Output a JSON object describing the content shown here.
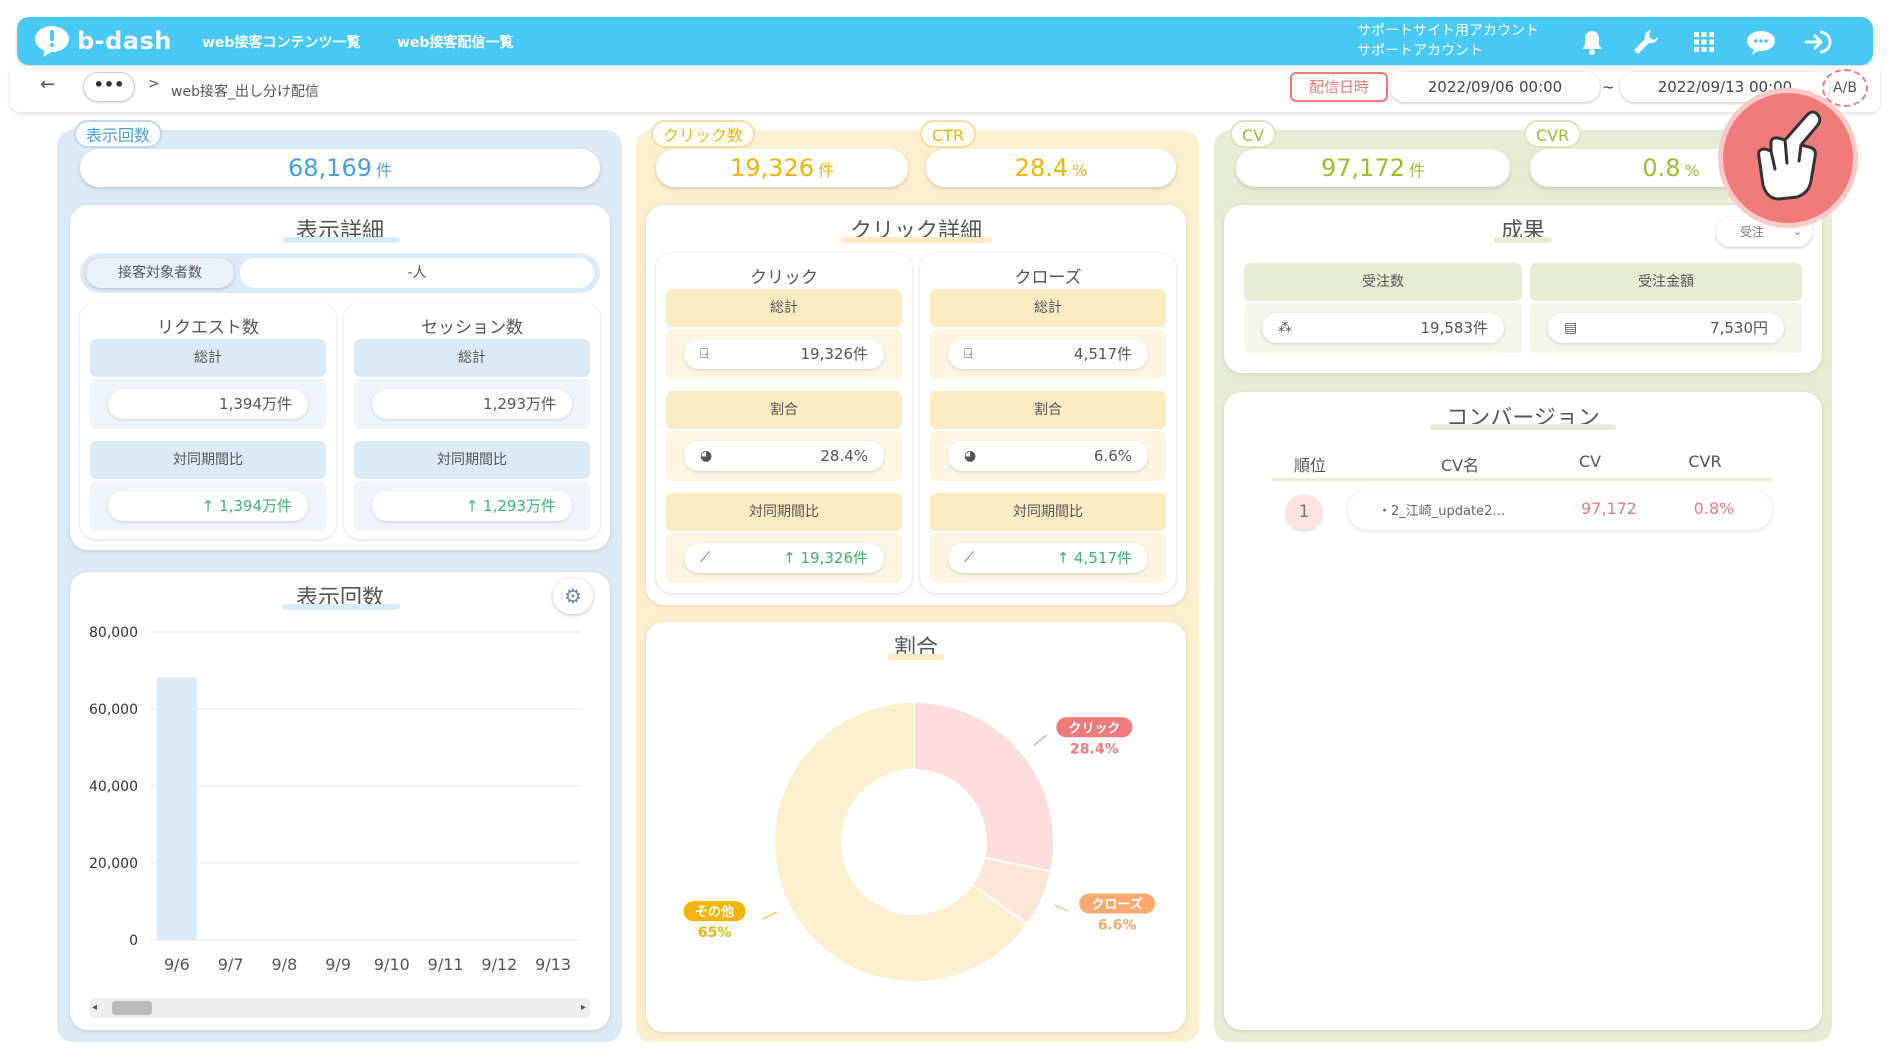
{
  "header": {
    "logo_text": "b-dash",
    "nav": [
      "web接客コンテンツ一覧",
      "web接客配信一覧"
    ],
    "account_line1": "サポートサイト用アカウント",
    "account_line2": "サポートアカウント",
    "icons": [
      "bell-icon",
      "wrench-icon",
      "grid-icon",
      "chat-icon",
      "logout-icon"
    ]
  },
  "subbar": {
    "back": "←",
    "more": "•••",
    "separator": ">",
    "breadcrumb": "web接客_出し分け配信",
    "date_badge": "配信日時",
    "date_from": "2022/09/06 00:00",
    "tilde": "~",
    "date_to": "2022/09/13 00:00",
    "ab_label": "A/B"
  },
  "colors": {
    "blue": "#4a9ee0",
    "yellow": "#f4b400",
    "green": "#9bbf2c",
    "accent_red": "#f07a7a",
    "up_green": "#3cb371"
  },
  "impressions": {
    "tag": "表示回数",
    "value": "68,169",
    "unit": "件",
    "detail_title": "表示詳細",
    "target_label": "接客対象者数",
    "target_value": "-人",
    "requests": {
      "title": "リクエスト数",
      "total_label": "総計",
      "total": "1,394万件",
      "compare_label": "対同期間比",
      "compare": "↑ 1,394万件"
    },
    "sessions": {
      "title": "セッション数",
      "total_label": "総計",
      "total": "1,293万件",
      "compare_label": "対同期間比",
      "compare": "↑ 1,293万件"
    },
    "chart_title": "表示回数"
  },
  "clicks": {
    "tag": "クリック数",
    "value": "19,326",
    "unit": "件",
    "ctr_tag": "CTR",
    "ctr_value": "28.4",
    "ctr_unit": "%",
    "detail_title": "クリック詳細",
    "click": {
      "title": "クリック",
      "total_label": "総計",
      "total": "19,326件",
      "ratio_label": "割合",
      "ratio": "28.4%",
      "compare_label": "対同期間比",
      "compare": "↑ 19,326件"
    },
    "close": {
      "title": "クローズ",
      "total_label": "総計",
      "total": "4,517件",
      "ratio_label": "割合",
      "ratio": "6.6%",
      "compare_label": "対同期間比",
      "compare": "↑ 4,517件"
    },
    "ratio_title": "割合"
  },
  "conversions": {
    "cv_tag": "CV",
    "cv_value": "97,172",
    "cv_unit": "件",
    "cvr_tag": "CVR",
    "cvr_value": "0.8",
    "cvr_unit": "%",
    "results_title": "成果",
    "results_select": "受注",
    "orders_label": "受注数",
    "orders_value": "19,583件",
    "amount_label": "受注金額",
    "amount_value": "7,530円",
    "conv_title": "コンバージョン",
    "table_headers": [
      "順位",
      "CV名",
      "CV",
      "CVR"
    ],
    "rows": [
      {
        "rank": "1",
        "name": "・2_江崎_update2…",
        "cv": "97,172",
        "cvr": "0.8%"
      }
    ]
  },
  "chart_data": [
    {
      "type": "bar",
      "title": "表示回数",
      "categories": [
        "9/6",
        "9/7",
        "9/8",
        "9/9",
        "9/10",
        "9/11",
        "9/12",
        "9/13"
      ],
      "values": [
        68169,
        0,
        0,
        0,
        0,
        0,
        0,
        0
      ],
      "ylim": [
        0,
        80000
      ],
      "yticks": [
        "80,000",
        "60,000",
        "40,000",
        "20,000",
        "0"
      ],
      "color": "#dceaf6",
      "grid": true
    },
    {
      "type": "pie",
      "title": "割合",
      "donut": true,
      "slices": [
        {
          "label": "クリック",
          "value": 28.4,
          "display": "28.4%",
          "color": "#fddcdc",
          "label_color": "#f07a7a"
        },
        {
          "label": "クローズ",
          "value": 6.6,
          "display": "6.6%",
          "color": "#fde6d6",
          "label_color": "#f9a870"
        },
        {
          "label": "その他",
          "value": 65,
          "display": "65%",
          "color": "#fcefcf",
          "label_color": "#f4b400"
        }
      ]
    }
  ]
}
